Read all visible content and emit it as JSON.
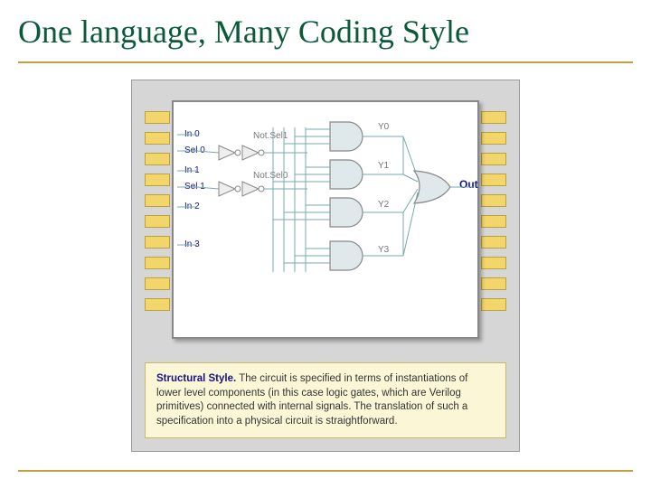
{
  "title": "One language, Many Coding Style",
  "signals": {
    "in0": "In 0",
    "sel0": "Sel 0",
    "in1": "In 1",
    "sel1": "Sel 1",
    "in2": "In 2",
    "in3": "In 3",
    "notsel1": "Not.Sel1",
    "notsel0": "Not.Sel0",
    "y0": "Y0",
    "y1": "Y1",
    "y2": "Y2",
    "y3": "Y3",
    "out": "Out"
  },
  "caption": {
    "lead": "Structural Style.",
    "body": " The circuit is specified in terms of instantiations of lower level components (in this case logic gates, which are Verilog primitives) connected with internal signals. The translation of such a specification into a physical circuit is straightforward."
  },
  "pins_per_side": 10
}
